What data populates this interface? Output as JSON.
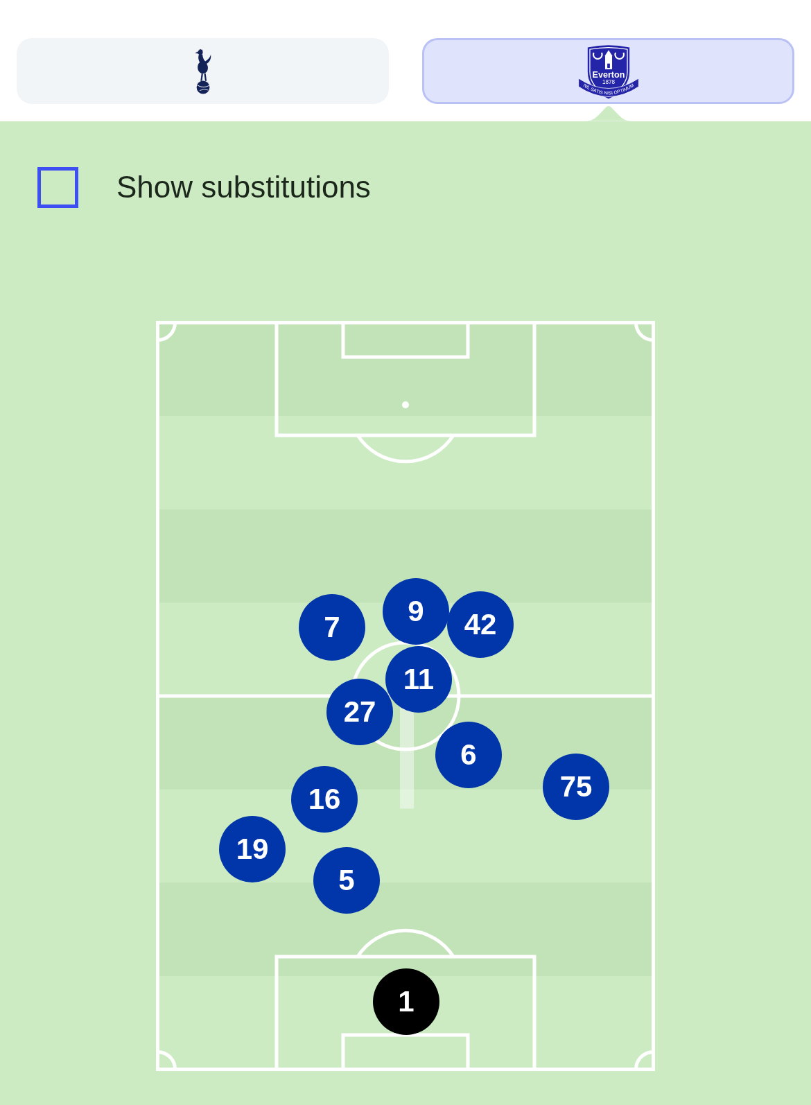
{
  "team_tabs": [
    {
      "kind": "cockerel",
      "selected": false
    },
    {
      "kind": "shield",
      "selected": true,
      "crest": {
        "title": "Everton",
        "year": "1878",
        "motto": "NIL SATIS NISI OPTIMUM"
      }
    }
  ],
  "substitutions_toggle": {
    "label": "Show substitutions",
    "checked": false
  },
  "pitch": {
    "players": [
      {
        "number": "7",
        "color": "#0036aa"
      },
      {
        "number": "9",
        "color": "#0036aa"
      },
      {
        "number": "42",
        "color": "#0036aa"
      },
      {
        "number": "11",
        "color": "#0036aa"
      },
      {
        "number": "27",
        "color": "#0036aa"
      },
      {
        "number": "6",
        "color": "#0036aa"
      },
      {
        "number": "16",
        "color": "#0036aa"
      },
      {
        "number": "75",
        "color": "#0036aa"
      },
      {
        "number": "19",
        "color": "#0036aa"
      },
      {
        "number": "5",
        "color": "#0036aa"
      },
      {
        "number": "1",
        "color": "#000000"
      }
    ]
  }
}
